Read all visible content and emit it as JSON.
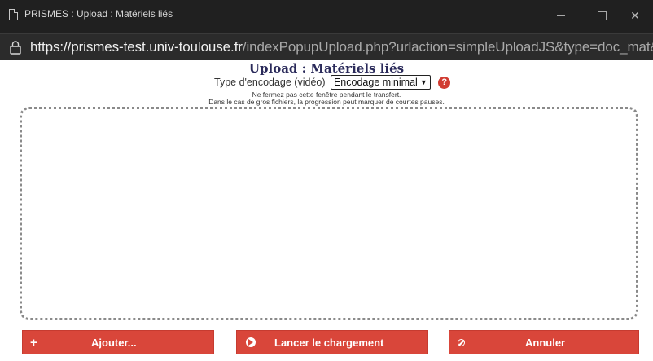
{
  "window": {
    "title": "PRISMES : Upload : Matériels liés"
  },
  "address_bar": {
    "url_host": "https://prismes-test.univ-toulouse.fr",
    "url_path": "/indexPopupUpload.php?urlaction=simpleUploadJS&type=doc_mat&i..."
  },
  "page": {
    "title": "Upload : Matériels liés",
    "encoding_label": "Type d'encodage (vidéo)",
    "encoding_value": "Encodage minimal",
    "help_glyph": "?",
    "note_line1": "Ne fermez pas cette fenêtre pendant le transfert.",
    "note_line2": "Dans le cas de gros fichiers, la progression peut marquer de courtes pauses."
  },
  "buttons": {
    "add": "Ajouter...",
    "start": "Lancer le chargement",
    "cancel": "Annuler"
  },
  "colors": {
    "accent": "#d9463a",
    "title_bar": "#202020",
    "address_bar": "#2b2b2b"
  }
}
